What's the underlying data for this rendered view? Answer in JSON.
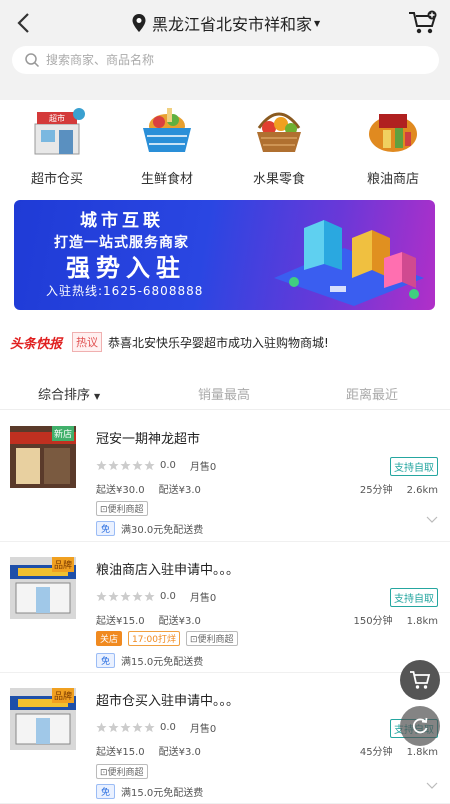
{
  "header": {
    "location": "黑龙江省北安市祥和家",
    "search_placeholder": "搜索商家、商品名称"
  },
  "categories": [
    {
      "label": "超市仓买",
      "icon": "supermarket-icon"
    },
    {
      "label": "生鲜食材",
      "icon": "fresh-basket-icon"
    },
    {
      "label": "水果零食",
      "icon": "fruit-basket-icon"
    },
    {
      "label": "粮油商店",
      "icon": "grain-oil-store-icon"
    }
  ],
  "banner": {
    "title": "城市互联",
    "subtitle": "打造一站式服务商家",
    "headline": "强势入驻",
    "hotline": "入驻热线:1625-6808888"
  },
  "news": {
    "logo": "头条快报",
    "tag": "热议",
    "text": "恭喜北安快乐孕婴超市成功入驻购物商城!"
  },
  "sort": {
    "tabs": [
      "综合排序",
      "销量最高",
      "距离最近"
    ],
    "active": 0
  },
  "shops": [
    {
      "name": "冠安一期神龙超市",
      "badge": "新店",
      "rating": "0.0",
      "sold": "月售0",
      "self_pickup": "支持自取",
      "min_order": "起送¥30.0",
      "delivery_fee": "配送¥3.0",
      "time": "25分钟",
      "distance": "2.6km",
      "tags": [
        "便利商超"
      ],
      "promo_tag": "免",
      "promo": "满30.0元免配送费"
    },
    {
      "name": "粮油商店入驻申请中。。。",
      "badge": "品牌",
      "rating": "0.0",
      "sold": "月售0",
      "self_pickup": "支持自取",
      "min_order": "起送¥15.0",
      "delivery_fee": "配送¥3.0",
      "time": "150分钟",
      "distance": "1.8km",
      "status": "关店",
      "open_time": "17:00打烊",
      "tags": [
        "便利商超"
      ],
      "promo_tag": "免",
      "promo": "满15.0元免配送费"
    },
    {
      "name": "超市仓买入驻申请中。。。",
      "badge": "品牌",
      "rating": "0.0",
      "sold": "月售0",
      "self_pickup": "支持自取",
      "min_order": "起送¥15.0",
      "delivery_fee": "配送¥3.0",
      "time": "45分钟",
      "distance": "1.8km",
      "tags": [
        "便利商超"
      ],
      "promo_tag": "免",
      "promo": "满15.0元免配送费"
    }
  ],
  "colors": {
    "accent_teal": "#25a6a0",
    "news_red": "#e02020",
    "banner_blue": "#2a46e2"
  }
}
